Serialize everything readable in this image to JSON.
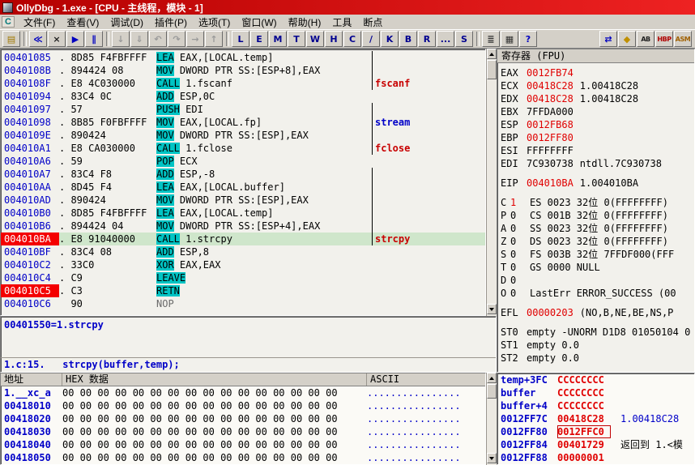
{
  "window": {
    "title": "OllyDbg - 1.exe - [CPU - 主线程，模块 - 1]"
  },
  "menu": {
    "child_icon": "C",
    "items": [
      "文件(F)",
      "查看(V)",
      "调试(D)",
      "插件(P)",
      "选项(T)",
      "窗口(W)",
      "帮助(H)",
      "工具",
      "断点"
    ]
  },
  "toolbar": {
    "groups": [
      {
        "buttons": [
          {
            "name": "open-file-button",
            "glyph": "▤",
            "color": "#a07800"
          }
        ]
      },
      {
        "buttons": [
          {
            "name": "restart-button",
            "glyph": "≪",
            "color": "#0000c0"
          },
          {
            "name": "close-program-button",
            "glyph": "×",
            "color": "#202020"
          },
          {
            "name": "run-button",
            "glyph": "▶",
            "color": "#0000c0"
          },
          {
            "name": "pause-button",
            "glyph": "∥",
            "color": "#0000c0"
          }
        ]
      },
      {
        "buttons": [
          {
            "name": "step-into-button",
            "glyph": "↓",
            "color": "#406080",
            "disabled": true
          },
          {
            "name": "step-over-button",
            "glyph": "⇓",
            "color": "#406080",
            "disabled": true
          },
          {
            "name": "animate-into-button",
            "glyph": "↶",
            "color": "#406080",
            "disabled": true
          },
          {
            "name": "animate-over-button",
            "glyph": "↷",
            "color": "#406080",
            "disabled": true
          },
          {
            "name": "execute-till-return-button",
            "glyph": "→",
            "color": "#406080",
            "disabled": true
          },
          {
            "name": "go-to-button",
            "glyph": "↑",
            "color": "#406080",
            "disabled": true
          }
        ]
      },
      {
        "buttons": [
          {
            "name": "log-window-button",
            "glyph": "L",
            "color": "#000090"
          },
          {
            "name": "executables-window-button",
            "glyph": "E",
            "color": "#000090"
          },
          {
            "name": "memory-window-button",
            "glyph": "M",
            "color": "#000090"
          },
          {
            "name": "threads-window-button",
            "glyph": "T",
            "color": "#000090"
          },
          {
            "name": "windows-window-button",
            "glyph": "W",
            "color": "#000090"
          },
          {
            "name": "handles-window-button",
            "glyph": "H",
            "color": "#000090"
          },
          {
            "name": "cpu-window-button",
            "glyph": "C",
            "color": "#000090"
          },
          {
            "name": "patches-window-button",
            "glyph": "/",
            "color": "#000090"
          },
          {
            "name": "call-stack-window-button",
            "glyph": "K",
            "color": "#000090"
          },
          {
            "name": "breakpoints-window-button",
            "glyph": "B",
            "color": "#000090"
          },
          {
            "name": "references-window-button",
            "glyph": "R",
            "color": "#000090"
          },
          {
            "name": "run-trace-window-button",
            "glyph": "...",
            "color": "#000090"
          },
          {
            "name": "source-window-button",
            "glyph": "S",
            "color": "#000090"
          }
        ]
      },
      {
        "buttons": [
          {
            "name": "options-list-button",
            "glyph": "≣",
            "color": "#303030"
          },
          {
            "name": "appearance-button",
            "glyph": "▦",
            "color": "#303030"
          },
          {
            "name": "help-button",
            "glyph": "?",
            "color": "#0000c0"
          }
        ]
      },
      {
        "right": true,
        "buttons": [
          {
            "name": "plugin-jump-button",
            "glyph": "⇄",
            "color": "#0000c0"
          },
          {
            "name": "plugin-gem-button",
            "glyph": "◆",
            "color": "#c09000"
          },
          {
            "name": "plugin-ab-button",
            "glyph": "AB",
            "color": "#202020",
            "small": true
          },
          {
            "name": "hardware-breakpoint-button",
            "glyph": "HBP",
            "color": "#b00000",
            "small": true
          },
          {
            "name": "asm-plugin-button",
            "glyph": "ASM",
            "color": "#a06000",
            "small": true
          }
        ]
      }
    ]
  },
  "disasm": {
    "rows": [
      {
        "addr": "00401085",
        "bytes": ". 8D85 F4FBFFFF",
        "mn": "LEA",
        "ops": "EAX,[LOCAL.temp]",
        "bar": true
      },
      {
        "addr": "0040108B",
        "bytes": ". 894424 08",
        "mn": "MOV",
        "ops": "DWORD PTR SS:[ESP+8],EAX",
        "bar": true
      },
      {
        "addr": "0040108F",
        "bytes": ". E8 4C030000",
        "mn": "CALL",
        "ops": "1.fscanf",
        "bar": true,
        "label": "fscanf",
        "label_color": "red"
      },
      {
        "addr": "00401094",
        "bytes": ". 83C4 0C",
        "mn": "ADD",
        "ops": "ESP,0C"
      },
      {
        "addr": "00401097",
        "bytes": ". 57",
        "mn": "PUSH",
        "ops": "EDI",
        "bar": true
      },
      {
        "addr": "00401098",
        "bytes": ". 8B85 F0FBFFFF",
        "mn": "MOV",
        "ops": "EAX,[LOCAL.fp]",
        "bar": true,
        "label": "stream",
        "label_color": "blue"
      },
      {
        "addr": "0040109E",
        "bytes": ". 890424",
        "mn": "MOV",
        "ops": "DWORD PTR SS:[ESP],EAX",
        "bar": true
      },
      {
        "addr": "004010A1",
        "bytes": ". E8 CA030000",
        "mn": "CALL",
        "ops": "1.fclose",
        "bar": true,
        "label": "fclose",
        "label_color": "red"
      },
      {
        "addr": "004010A6",
        "bytes": ". 59",
        "mn": "POP",
        "ops": "ECX"
      },
      {
        "addr": "004010A7",
        "bytes": ". 83C4 F8",
        "mn": "ADD",
        "ops": "ESP,-8",
        "bar": true
      },
      {
        "addr": "004010AA",
        "bytes": ". 8D45 F4",
        "mn": "LEA",
        "ops": "EAX,[LOCAL.buffer]",
        "bar": true
      },
      {
        "addr": "004010AD",
        "bytes": ". 890424",
        "mn": "MOV",
        "ops": "DWORD PTR SS:[ESP],EAX",
        "bar": true
      },
      {
        "addr": "004010B0",
        "bytes": ". 8D85 F4FBFFFF",
        "mn": "LEA",
        "ops": "EAX,[LOCAL.temp]",
        "bar": true
      },
      {
        "addr": "004010B6",
        "bytes": ". 894424 04",
        "mn": "MOV",
        "ops": "DWORD PTR SS:[ESP+4],EAX",
        "bar": true
      },
      {
        "addr": "004010BA",
        "bytes": ". E8 91040000",
        "mn": "CALL",
        "ops": "1.strcpy",
        "bar": true,
        "label": "strcpy",
        "label_color": "red",
        "breakpoint": true,
        "selected": true
      },
      {
        "addr": "004010BF",
        "bytes": ". 83C4 08",
        "mn": "ADD",
        "ops": "ESP,8"
      },
      {
        "addr": "004010C2",
        "bytes": ". 33C0",
        "mn": "XOR",
        "ops": "EAX,EAX"
      },
      {
        "addr": "004010C4",
        "bytes": ". C9",
        "mn": "LEAVE",
        "ops": ""
      },
      {
        "addr": "004010C5",
        "bytes": ". C3",
        "mn": "RETN",
        "ops": "",
        "breakpoint": true
      },
      {
        "addr": "004010C6",
        "bytes": "  90",
        "mn": "NOP",
        "ops": "",
        "plain": true
      }
    ]
  },
  "registers": {
    "header": "寄存器 (FPU)",
    "lines": [
      {
        "t": "reg",
        "label": "EAX",
        "value": "0012FB74",
        "changed": true,
        "extra": ""
      },
      {
        "t": "reg",
        "label": "ECX",
        "value": "00418C28",
        "changed": true,
        "extra": "1.00418C28"
      },
      {
        "t": "reg",
        "label": "EDX",
        "value": "00418C28",
        "changed": true,
        "extra": "1.00418C28"
      },
      {
        "t": "reg",
        "label": "EBX",
        "value": "7FFDA000",
        "changed": false,
        "extra": ""
      },
      {
        "t": "reg",
        "label": "ESP",
        "value": "0012FB68",
        "changed": true,
        "extra": ""
      },
      {
        "t": "reg",
        "label": "EBP",
        "value": "0012FF80",
        "changed": true,
        "extra": ""
      },
      {
        "t": "reg",
        "label": "ESI",
        "value": "FFFFFFFF",
        "changed": false,
        "extra": ""
      },
      {
        "t": "reg",
        "label": "EDI",
        "value": "7C930738",
        "changed": false,
        "extra": "ntdll.7C930738"
      },
      {
        "t": "gap"
      },
      {
        "t": "reg",
        "label": "EIP",
        "value": "004010BA",
        "changed": true,
        "extra": "1.004010BA"
      },
      {
        "t": "gap"
      },
      {
        "t": "flag",
        "flag": "C",
        "fval": "1",
        "fchanged": true,
        "seg": "ES 0023 32位 0(FFFFFFFF)"
      },
      {
        "t": "flag",
        "flag": "P",
        "fval": "0",
        "fchanged": false,
        "seg": "CS 001B 32位 0(FFFFFFFF)"
      },
      {
        "t": "flag",
        "flag": "A",
        "fval": "0",
        "fchanged": false,
        "seg": "SS 0023 32位 0(FFFFFFFF)"
      },
      {
        "t": "flag",
        "flag": "Z",
        "fval": "0",
        "fchanged": false,
        "seg": "DS 0023 32位 0(FFFFFFFF)"
      },
      {
        "t": "flag",
        "flag": "S",
        "fval": "0",
        "fchanged": false,
        "seg": "FS 003B 32位 7FFDF000(FFF"
      },
      {
        "t": "flag",
        "flag": "T",
        "fval": "0",
        "fchanged": false,
        "seg": "GS 0000 NULL"
      },
      {
        "t": "flag",
        "flag": "D",
        "fval": "0",
        "fchanged": false,
        "seg": ""
      },
      {
        "t": "flag",
        "flag": "O",
        "fval": "0",
        "fchanged": false,
        "seg": "LastErr ERROR_SUCCESS (00"
      },
      {
        "t": "gap"
      },
      {
        "t": "reg",
        "label": "EFL",
        "value": "00000203",
        "changed": true,
        "extra": "(NO,B,NE,BE,NS,P"
      },
      {
        "t": "gap"
      },
      {
        "t": "st",
        "label": "ST0",
        "value": "empty -UNORM D1D8 01050104 0",
        "changed": false,
        "extra": ""
      },
      {
        "t": "st",
        "label": "ST1",
        "value": "empty 0.0",
        "changed": false,
        "extra": ""
      },
      {
        "t": "st",
        "label": "ST2",
        "value": "empty 0.0",
        "changed": false,
        "extra": ""
      }
    ]
  },
  "info": {
    "line1": "00401550=1.strcpy",
    "line2": "1.c:15.   strcpy(buffer,temp);"
  },
  "dump": {
    "headers": [
      "地址",
      "HEX 数据",
      "ASCII"
    ],
    "rows": [
      {
        "addr": "1.__xc_a",
        "hex": "00 00 00 00 00 00 00 00 00 00 00 00 00 00 00 00",
        "ascii": "................"
      },
      {
        "addr": "00418010",
        "hex": "00 00 00 00 00 00 00 00 00 00 00 00 00 00 00 00",
        "ascii": "................"
      },
      {
        "addr": "00418020",
        "hex": "00 00 00 00 00 00 00 00 00 00 00 00 00 00 00 00",
        "ascii": "................"
      },
      {
        "addr": "00418030",
        "hex": "00 00 00 00 00 00 00 00 00 00 00 00 00 00 00 00",
        "ascii": "................"
      },
      {
        "addr": "00418040",
        "hex": "00 00 00 00 00 00 00 00 00 00 00 00 00 00 00 00",
        "ascii": "................"
      },
      {
        "addr": "00418050",
        "hex": "00 00 00 00 00 00 00 00 00 00 00 00 00 00 00 00",
        "ascii": "................"
      }
    ]
  },
  "stack": {
    "rows": [
      {
        "addr": "temp+3FC",
        "value": "CCCCCCCC",
        "comment": ""
      },
      {
        "addr": "buffer",
        "value": "CCCCCCCC",
        "comment": ""
      },
      {
        "addr": "buffer+4",
        "value": "CCCCCCCC",
        "comment": ""
      },
      {
        "addr": "0012FF7C",
        "value": "00418C28",
        "comment": "1.00418C28",
        "comment_color": "blue"
      },
      {
        "addr": "0012FF80",
        "value": "0012FFC0",
        "comment": "",
        "boxed": true
      },
      {
        "addr": "0012FF84",
        "value": "00401729",
        "comment": "返回到 1.<模",
        "comment_color": "black"
      },
      {
        "addr": "0012FF88",
        "value": "00000001",
        "comment": ""
      }
    ]
  }
}
